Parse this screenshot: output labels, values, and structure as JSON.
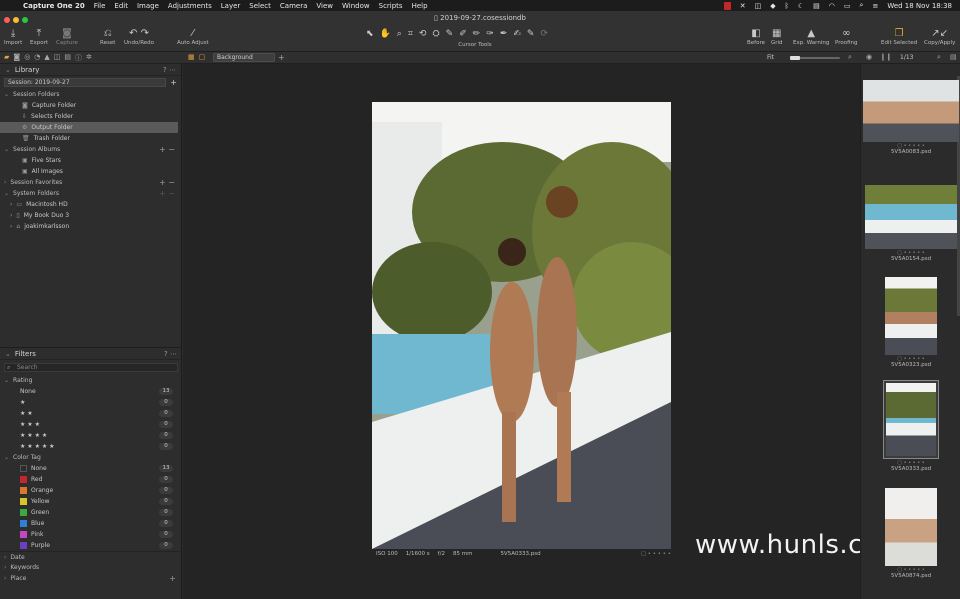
{
  "menubar": {
    "apple": "",
    "app": "Capture One 20",
    "items": [
      "File",
      "Edit",
      "Image",
      "Adjustments",
      "Layer",
      "Select",
      "Camera",
      "View",
      "Window",
      "Scripts",
      "Help"
    ],
    "clock": "Wed 18 Nov  18:38"
  },
  "window": {
    "title": "2019-09-27.cosessiondb"
  },
  "toolbar": {
    "import": "Import",
    "export": "Export",
    "capture": "Capture",
    "reset": "Reset",
    "undo_redo": "Undo/Redo",
    "auto_adjust": "Auto Adjust",
    "cursor_tools": "Cursor Tools",
    "before": "Before",
    "grid": "Grid",
    "exp_warning": "Exp. Warning",
    "proofing": "Proofing",
    "edit_selected": "Edit Selected",
    "copy_apply": "Copy/Apply"
  },
  "viewer_bar": {
    "background": "Background",
    "fit": "Fit",
    "count": "1/13"
  },
  "library": {
    "title": "Library",
    "session": "Session: 2019-09-27",
    "session_folders": {
      "label": "Session Folders",
      "items": [
        "Capture Folder",
        "Selects Folder",
        "Output Folder",
        "Trash Folder"
      ]
    },
    "session_albums": {
      "label": "Session Albums",
      "items": [
        "Five Stars",
        "All Images"
      ]
    },
    "session_favorites": {
      "label": "Session Favorites"
    },
    "system_folders": {
      "label": "System Folders",
      "items": [
        "Macintosh HD",
        "My Book Duo 3",
        "joakimkarlsson"
      ]
    }
  },
  "filters": {
    "title": "Filters",
    "search_placeholder": "Search",
    "rating": {
      "label": "Rating",
      "rows": [
        {
          "label": "None",
          "count": "13"
        },
        {
          "label": "★",
          "count": "0"
        },
        {
          "label": "★ ★",
          "count": "0"
        },
        {
          "label": "★ ★ ★",
          "count": "0"
        },
        {
          "label": "★ ★ ★ ★",
          "count": "0"
        },
        {
          "label": "★ ★ ★ ★ ★",
          "count": "0"
        }
      ]
    },
    "color_tag": {
      "label": "Color Tag",
      "rows": [
        {
          "label": "None",
          "count": "13",
          "color": "transparent"
        },
        {
          "label": "Red",
          "count": "0",
          "color": "#c0282a"
        },
        {
          "label": "Orange",
          "count": "0",
          "color": "#d9772a"
        },
        {
          "label": "Yellow",
          "count": "0",
          "color": "#d8c52a"
        },
        {
          "label": "Green",
          "count": "0",
          "color": "#3aa843"
        },
        {
          "label": "Blue",
          "count": "0",
          "color": "#2f7fd6"
        },
        {
          "label": "Pink",
          "count": "0",
          "color": "#c447c0"
        },
        {
          "label": "Purple",
          "count": "0",
          "color": "#6a3fc0"
        }
      ]
    },
    "date": "Date",
    "keywords": "Keywords",
    "place": "Place"
  },
  "image": {
    "iso": "ISO 100",
    "shutter": "1/1600 s",
    "aperture": "f/2",
    "focal": "85 mm",
    "file": "5V5A0333.psd"
  },
  "thumbnails": [
    "5V5A0083.psd",
    "5V5A0154.psd",
    "5V5A0323.psd",
    "5V5A0333.psd",
    "5V5A0874.psd"
  ],
  "watermark": "www.hunls.com"
}
